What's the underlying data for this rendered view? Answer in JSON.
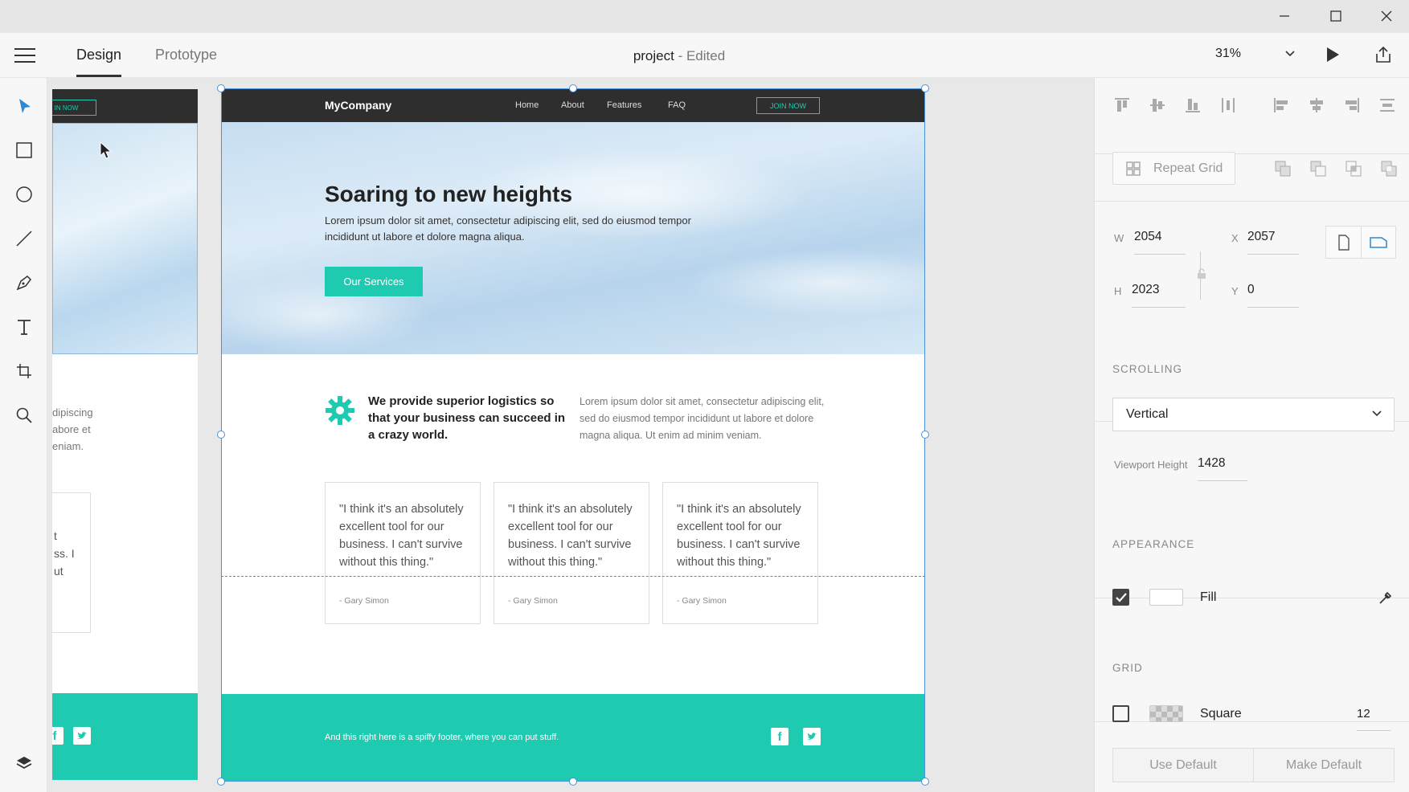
{
  "app": {
    "tabs": [
      {
        "label": "Design"
      },
      {
        "label": "Prototype"
      }
    ],
    "document": {
      "name": "project",
      "status": "- Edited"
    },
    "zoom": "31%"
  },
  "window_controls": [
    "minimize-icon",
    "maximize-icon",
    "close-icon"
  ],
  "tools": [
    "select-tool-icon",
    "rectangle-tool-icon",
    "ellipse-tool-icon",
    "line-tool-icon",
    "pen-tool-icon",
    "text-tool-icon",
    "artboard-tool-icon",
    "zoom-tool-icon"
  ],
  "left_artboard": {
    "join": "IN NOW",
    "text_lines": [
      "dipiscing",
      "abore et",
      "eniam."
    ],
    "card_lines": [
      "t",
      "ss. I",
      "ut"
    ]
  },
  "artboard": {
    "nav": {
      "logo": "MyCompany",
      "links": [
        "Home",
        "About",
        "Features",
        "FAQ"
      ],
      "join": "JOIN NOW"
    },
    "hero": {
      "title": "Soaring to new heights",
      "subtitle": "Lorem ipsum dolor sit amet, consectetur adipiscing elit, sed do eiusmod tempor incididunt ut labore et dolore magna aliqua.",
      "button": "Our Services"
    },
    "feature": {
      "title": "We provide superior logistics so that your business can succeed in a crazy world.",
      "text": "Lorem ipsum dolor sit amet, consectetur adipiscing elit, sed do eiusmod tempor incididunt ut labore et dolore magna aliqua. Ut enim ad minim veniam."
    },
    "testimonials": [
      {
        "quote": "\"I think it's an absolutely excellent tool for our business. I can't survive without this thing.\"",
        "author": "- Gary Simon"
      },
      {
        "quote": "\"I think it's an absolutely excellent tool for our business. I can't survive without this thing.\"",
        "author": "- Gary Simon"
      },
      {
        "quote": "\"I think it's an absolutely excellent tool for our business. I can't survive without this thing.\"",
        "author": "- Gary Simon"
      }
    ],
    "footer": {
      "text": "And this right here is a spiffy footer, where you can put stuff."
    }
  },
  "panel": {
    "repeat_grid": "Repeat Grid",
    "dimensions": {
      "w_label": "W",
      "w": "2054",
      "h_label": "H",
      "h": "2023",
      "x_label": "X",
      "x": "2057",
      "y_label": "Y",
      "y": "0"
    },
    "scrolling": {
      "title": "SCROLLING",
      "value": "Vertical",
      "viewport_label": "Viewport Height",
      "viewport_value": "1428"
    },
    "appearance": {
      "title": "APPEARANCE",
      "fill_label": "Fill",
      "fill_checked": true
    },
    "grid": {
      "title": "GRID",
      "type": "Square",
      "size": "12",
      "checked": false,
      "use_default": "Use Default",
      "make_default": "Make Default"
    }
  },
  "colors": {
    "accent": "#1ecab0",
    "selection": "#4a90d9",
    "nav_dark": "#2e2e2e"
  }
}
